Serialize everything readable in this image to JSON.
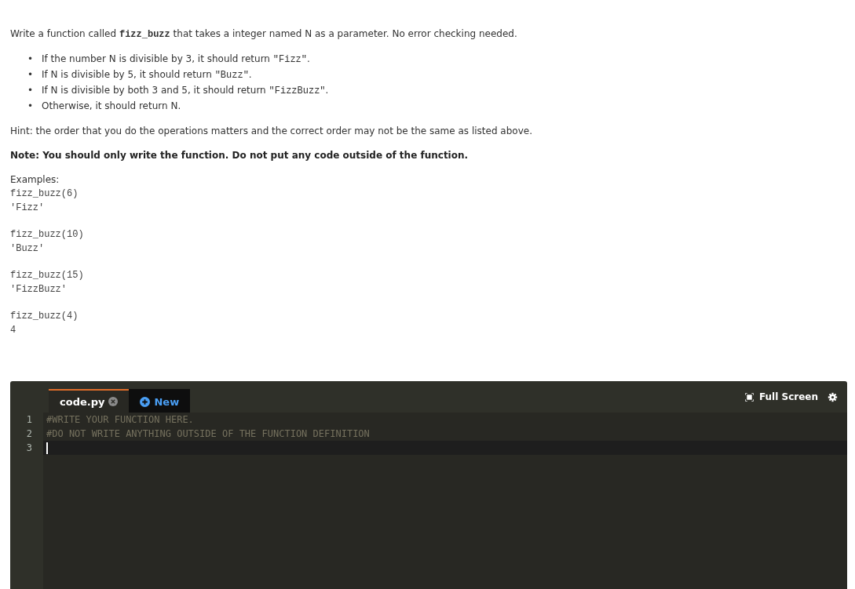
{
  "intro": [
    {
      "text": "Write a function called ",
      "code": false
    },
    {
      "text": "fizz_buzz",
      "code": true
    },
    {
      "text": " that takes a integer named N as a parameter.  No error checking needed.",
      "code": false
    }
  ],
  "bullets": [
    {
      "marker": "•",
      "parts": [
        {
          "text": "If the number N is divisible by 3, it should return ",
          "code": false
        },
        {
          "text": "\"Fizz\"",
          "code": true
        },
        {
          "text": ".",
          "code": false
        }
      ]
    },
    {
      "marker": "•",
      "parts": [
        {
          "text": "If N is divisible by 5, it should return ",
          "code": false
        },
        {
          "text": "\"Buzz\"",
          "code": true
        },
        {
          "text": ".",
          "code": false
        }
      ]
    },
    {
      "marker": "•",
      "parts": [
        {
          "text": "If N is divisible by both 3 and 5, it should return ",
          "code": false
        },
        {
          "text": "\"FizzBuzz\"",
          "code": true
        },
        {
          "text": ".",
          "code": false
        }
      ]
    },
    {
      "marker": "•",
      "parts": [
        {
          "text": "Otherwise, it should return N.",
          "code": false
        }
      ]
    }
  ],
  "hint": "Hint: the order that you do the operations matters and the correct order may not be the same as listed above.",
  "note": "Note: You should only write the function. Do not put any code outside of the function.",
  "examples_label": "Examples:",
  "examples": [
    {
      "call": "fizz_buzz(6)",
      "result": "'Fizz'"
    },
    {
      "call": "fizz_buzz(10)",
      "result": "'Buzz'"
    },
    {
      "call": "fizz_buzz(15)",
      "result": "'FizzBuzz'"
    },
    {
      "call": "fizz_buzz(4)",
      "result": "4"
    }
  ],
  "editor": {
    "tabs": [
      {
        "kind": "file",
        "label": "code.py",
        "selected": true
      },
      {
        "kind": "new",
        "label": "New",
        "selected": false
      }
    ],
    "full_screen": "Full Screen",
    "lines": [
      {
        "number": "1",
        "text": "#WRITE YOUR FUNCTION HERE.",
        "current": false
      },
      {
        "number": "2",
        "text": "#DO NOT WRITE ANYTHING OUTSIDE OF THE FUNCTION DEFINITION",
        "current": false
      },
      {
        "number": "3",
        "current": true
      }
    ]
  }
}
